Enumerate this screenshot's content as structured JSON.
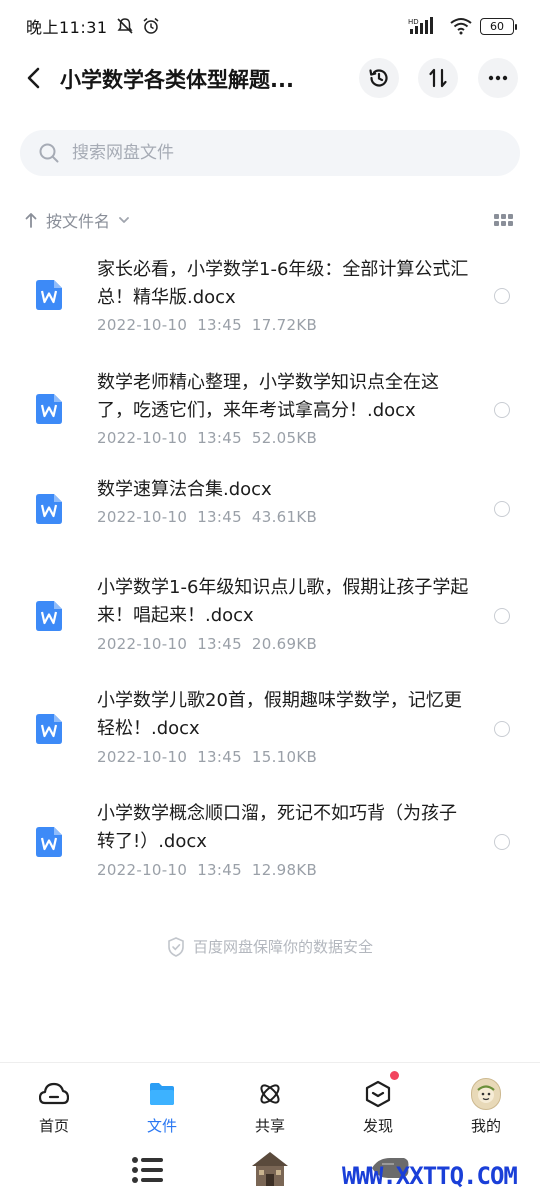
{
  "status_bar": {
    "time": "晚上11:31",
    "network": "HD",
    "battery": "60"
  },
  "header": {
    "title": "小学数学各类体型解题...",
    "back_icon": "chevron-left-icon",
    "history_icon": "history-icon",
    "sort_icon": "sort-icon",
    "more_icon": "more-icon"
  },
  "search": {
    "placeholder": "搜索网盘文件"
  },
  "sort": {
    "label": "按文件名"
  },
  "files": [
    {
      "name": "家长必看，小学数学1-6年级：全部计算公式汇总！精华版.docx",
      "date": "2022-10-10",
      "time": "13:45",
      "size": "17.72KB"
    },
    {
      "name": "数学老师精心整理，小学数学知识点全在这了，吃透它们，来年考试拿高分！.docx",
      "date": "2022-10-10",
      "time": "13:45",
      "size": "52.05KB"
    },
    {
      "name": "数学速算法合集.docx",
      "date": "2022-10-10",
      "time": "13:45",
      "size": "43.61KB"
    },
    {
      "name": "小学数学1-6年级知识点儿歌，假期让孩子学起来！唱起来！.docx",
      "date": "2022-10-10",
      "time": "13:45",
      "size": "20.69KB"
    },
    {
      "name": "小学数学儿歌20首，假期趣味学数学，记忆更轻松！.docx",
      "date": "2022-10-10",
      "time": "13:45",
      "size": "15.10KB"
    },
    {
      "name": "小学数学概念顺口溜，死记不如巧背（为孩子转了!）.docx",
      "date": "2022-10-10",
      "time": "13:45",
      "size": "12.98KB"
    }
  ],
  "footer_note": "百度网盘保障你的数据安全",
  "nav": [
    {
      "label": "首页",
      "icon": "home-icon"
    },
    {
      "label": "文件",
      "icon": "folder-icon"
    },
    {
      "label": "共享",
      "icon": "share-atom-icon"
    },
    {
      "label": "发现",
      "icon": "discover-icon"
    },
    {
      "label": "我的",
      "icon": "avatar"
    }
  ],
  "colors": {
    "accent": "#2a77f2",
    "word_icon": "#3d8af7",
    "badge": "#f2455f"
  },
  "watermark": "WWW.XXTTQ.COM"
}
